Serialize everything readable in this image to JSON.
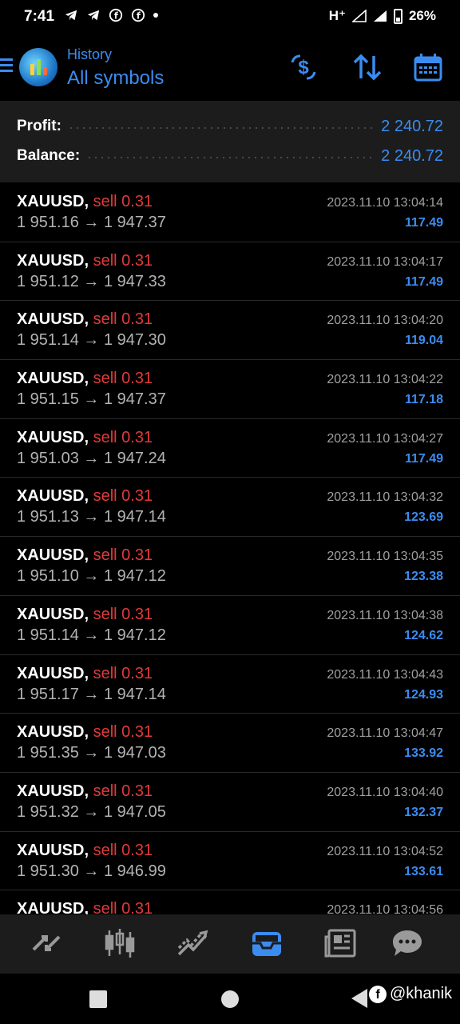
{
  "status_bar": {
    "time": "7:41",
    "network": "H⁺",
    "battery": "26%"
  },
  "header": {
    "subtitle": "History",
    "title": "All symbols",
    "icons": [
      "menu-icon",
      "app-logo",
      "currency-exchange-icon",
      "sort-icon",
      "calendar-icon"
    ]
  },
  "summary": {
    "profit_label": "Profit:",
    "profit_value": "2 240.72",
    "balance_label": "Balance:",
    "balance_value": "2 240.72"
  },
  "deals": [
    {
      "symbol": "XAUUSD,",
      "side": "sell 0.31",
      "prices": "1 951.16 → 1 947.37",
      "time": "2023.11.10 13:04:14",
      "profit": "117.49"
    },
    {
      "symbol": "XAUUSD,",
      "side": "sell 0.31",
      "prices": "1 951.12 → 1 947.33",
      "time": "2023.11.10 13:04:17",
      "profit": "117.49"
    },
    {
      "symbol": "XAUUSD,",
      "side": "sell 0.31",
      "prices": "1 951.14 → 1 947.30",
      "time": "2023.11.10 13:04:20",
      "profit": "119.04"
    },
    {
      "symbol": "XAUUSD,",
      "side": "sell 0.31",
      "prices": "1 951.15 → 1 947.37",
      "time": "2023.11.10 13:04:22",
      "profit": "117.18"
    },
    {
      "symbol": "XAUUSD,",
      "side": "sell 0.31",
      "prices": "1 951.03 → 1 947.24",
      "time": "2023.11.10 13:04:27",
      "profit": "117.49"
    },
    {
      "symbol": "XAUUSD,",
      "side": "sell 0.31",
      "prices": "1 951.13 → 1 947.14",
      "time": "2023.11.10 13:04:32",
      "profit": "123.69"
    },
    {
      "symbol": "XAUUSD,",
      "side": "sell 0.31",
      "prices": "1 951.10 → 1 947.12",
      "time": "2023.11.10 13:04:35",
      "profit": "123.38"
    },
    {
      "symbol": "XAUUSD,",
      "side": "sell 0.31",
      "prices": "1 951.14 → 1 947.12",
      "time": "2023.11.10 13:04:38",
      "profit": "124.62"
    },
    {
      "symbol": "XAUUSD,",
      "side": "sell 0.31",
      "prices": "1 951.17 → 1 947.14",
      "time": "2023.11.10 13:04:43",
      "profit": "124.93"
    },
    {
      "symbol": "XAUUSD,",
      "side": "sell 0.31",
      "prices": "1 951.35 → 1 947.03",
      "time": "2023.11.10 13:04:47",
      "profit": "133.92"
    },
    {
      "symbol": "XAUUSD,",
      "side": "sell 0.31",
      "prices": "1 951.32 → 1 947.05",
      "time": "2023.11.10 13:04:40",
      "profit": "132.37"
    },
    {
      "symbol": "XAUUSD,",
      "side": "sell 0.31",
      "prices": "1 951.30 → 1 946.99",
      "time": "2023.11.10 13:04:52",
      "profit": "133.61"
    },
    {
      "symbol": "XAUUSD,",
      "side": "sell 0.31",
      "prices": "",
      "time": "2023.11.10 13:04:56",
      "profit": ""
    }
  ],
  "bottom_nav": {
    "items": [
      "quotes-icon",
      "chart-icon",
      "trade-icon",
      "history-icon",
      "news-icon",
      "messages-icon"
    ],
    "active": "history-icon"
  },
  "watermark": {
    "text": "@khanik"
  },
  "colors": {
    "accent": "#3b8cf0",
    "sell": "#e23a3a",
    "background": "#000000",
    "panel": "#1c1c1c"
  }
}
